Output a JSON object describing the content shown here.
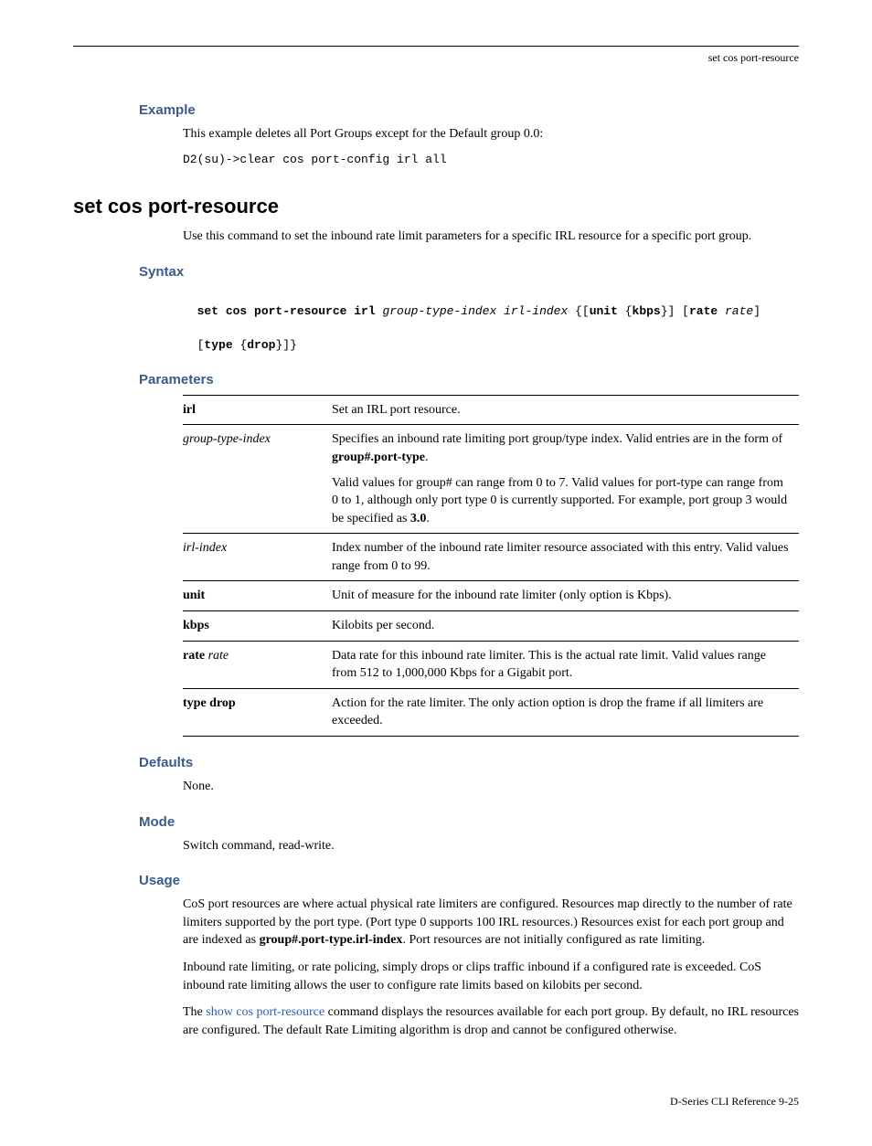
{
  "header": {
    "right": "set cos port-resource"
  },
  "example": {
    "heading": "Example",
    "text": "This example deletes all Port Groups except for the Default group 0.0:",
    "code": "D2(su)->clear cos port-config irl all"
  },
  "command": {
    "title": "set cos port-resource",
    "intro": "Use this command to set the inbound rate limit parameters for a specific IRL resource for a specific port group."
  },
  "syntax": {
    "heading": "Syntax",
    "cmd_bold1": "set cos port-resource irl ",
    "cmd_ital1": "group-type-index irl-index",
    "cmd_plain1": " {[",
    "cmd_bold2": "unit",
    "cmd_plain2": " {",
    "cmd_bold3": "kbps",
    "cmd_plain3": "}] [",
    "cmd_bold4": "rate ",
    "cmd_ital2": "rate",
    "cmd_plain4": "]",
    "line2_plain1": "[",
    "line2_bold1": "type",
    "line2_plain2": " {",
    "line2_bold2": "drop",
    "line2_plain3": "}]}"
  },
  "parameters": {
    "heading": "Parameters",
    "rows": [
      {
        "name_bold": "irl",
        "desc": "Set an IRL port resource."
      },
      {
        "name_ital": "group-type-index",
        "desc_a": "Specifies an inbound rate limiting port group/type index. Valid entries are in the form of ",
        "desc_b_bold": "group#.port-type",
        "desc_c": ".",
        "desc2_a": "Valid values for group# can range from 0 to 7. Valid values for port-type can range from 0 to 1, although only port type 0 is currently supported. For example, port group 3 would be specified as ",
        "desc2_b_bold": "3.0",
        "desc2_c": "."
      },
      {
        "name_ital": "irl-index",
        "desc": "Index number of the inbound rate limiter resource associated with this entry. Valid values range from 0 to 99."
      },
      {
        "name_bold": "unit",
        "desc": "Unit of measure for the inbound rate limiter (only option is Kbps)."
      },
      {
        "name_bold": "kbps",
        "desc": "Kilobits per second."
      },
      {
        "name_bold": "rate ",
        "name_ital": "rate",
        "desc": "Data rate for this inbound rate limiter. This is the actual rate limit. Valid values range from 512 to 1,000,000 Kbps for a Gigabit port."
      },
      {
        "name_bold": "type drop",
        "desc": "Action for the rate limiter. The only action option is drop the frame if all limiters are exceeded."
      }
    ]
  },
  "defaults": {
    "heading": "Defaults",
    "text": "None."
  },
  "mode": {
    "heading": "Mode",
    "text": "Switch command, read-write."
  },
  "usage": {
    "heading": "Usage",
    "p1a": "CoS port resources are where actual physical rate limiters are configured. Resources map directly to the number of rate limiters supported by the port type. (Port type 0 supports 100 IRL resources.) Resources exist for each port group and are indexed as ",
    "p1b_bold": "group#.port-type.irl-index",
    "p1c": ". Port resources are not initially configured as rate limiting.",
    "p2": "Inbound rate limiting, or rate policing, simply drops or clips traffic inbound if a configured rate is exceeded. CoS inbound rate limiting allows the user to configure rate limits based on kilobits per second.",
    "p3a": "The ",
    "p3_link": "show cos port-resource",
    "p3b": " command displays the resources available for each port group. By default, no IRL resources are configured. The default Rate Limiting algorithm is drop and cannot be configured otherwise."
  },
  "footer": {
    "text": "D-Series CLI Reference   9-25"
  }
}
